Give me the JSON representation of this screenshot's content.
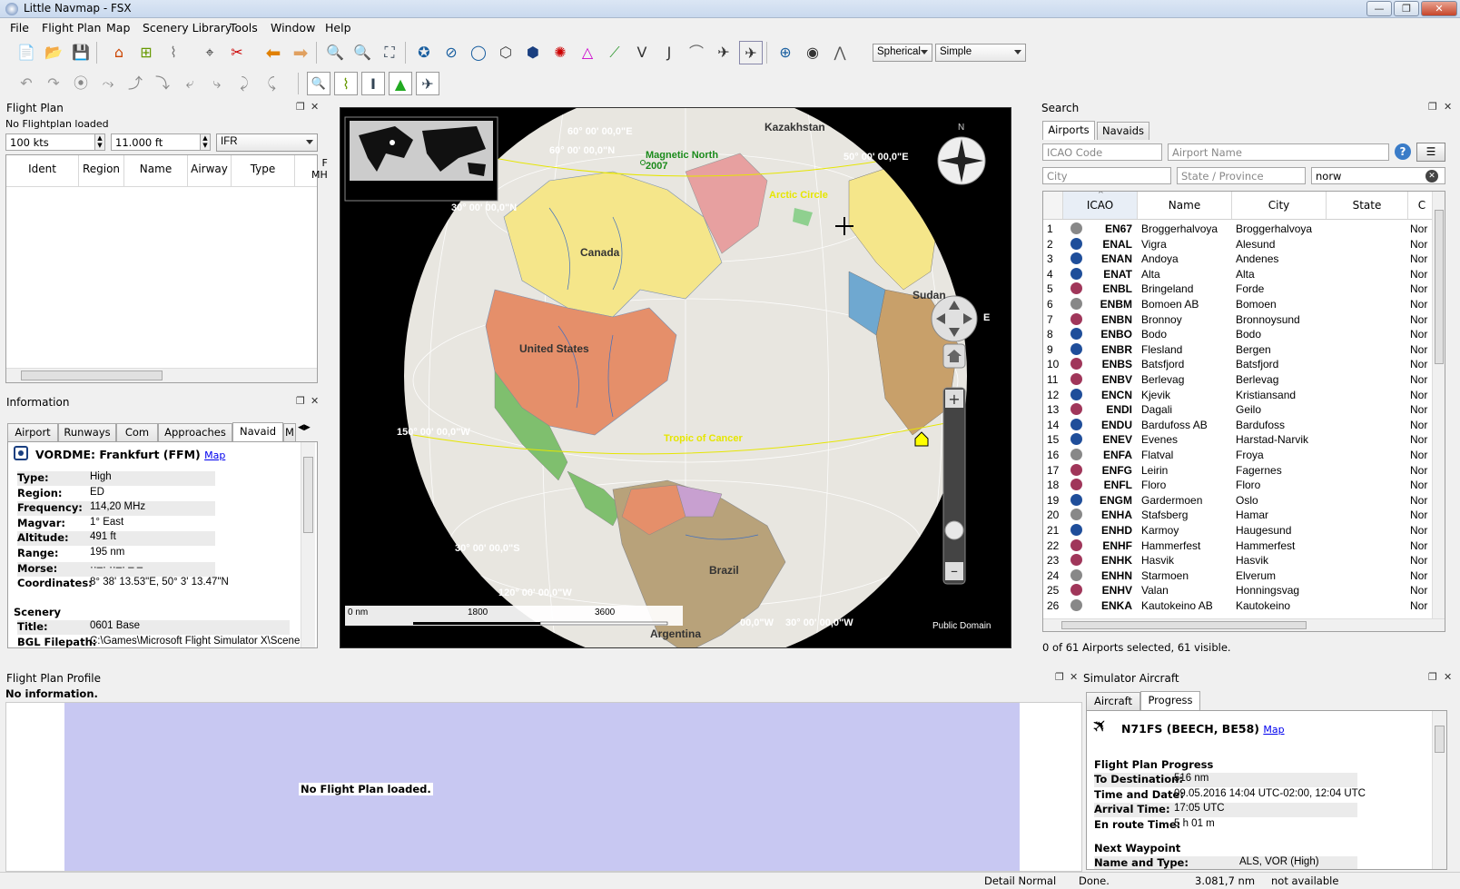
{
  "window": {
    "title": "Little Navmap - FSX"
  },
  "menu": [
    "File",
    "Flight Plan",
    "Map",
    "Scenery Library",
    "Tools",
    "Window",
    "Help"
  ],
  "toolbar": {
    "projection": "Spherical",
    "theme": "Simple"
  },
  "flight_plan": {
    "dock_title": "Flight Plan",
    "status": "No Flightplan loaded",
    "speed": "100 kts",
    "altitude": "11.000 ft",
    "rules": "IFR",
    "columns": [
      "Ident",
      "Region",
      "Name",
      "Airway",
      "Type"
    ],
    "col_cut_top": "F",
    "col_cut_bot": "MH"
  },
  "information": {
    "dock_title": "Information",
    "tabs": [
      "Airport",
      "Runways",
      "Com",
      "Approaches",
      "Navaid",
      "M"
    ],
    "heading": "VORDME: Frankfurt (FFM)",
    "map_link": "Map",
    "rows": [
      {
        "k": "Type:",
        "v": "High"
      },
      {
        "k": "Region:",
        "v": "ED"
      },
      {
        "k": "Frequency:",
        "v": "114,20 MHz"
      },
      {
        "k": "Magvar:",
        "v": "1° East"
      },
      {
        "k": "Altitude:",
        "v": "491 ft"
      },
      {
        "k": "Range:",
        "v": "195 nm"
      },
      {
        "k": "Morse:",
        "v": "··–·  ··–·  – –"
      },
      {
        "k": "Coordinates:",
        "v": "8° 38' 13.53\"E, 50° 3' 13.47\"N"
      }
    ],
    "scenery_heading": "Scenery",
    "scenery_rows": [
      {
        "k": "Title:",
        "v": "0601 Base"
      },
      {
        "k": "BGL Filepath:",
        "v": "C:\\Games\\Microsoft Flight Simulator X\\Scenery"
      }
    ]
  },
  "map": {
    "labels": {
      "kazakhstan": "Kazakhstan",
      "magnetic_north": "Magnetic North",
      "mn_year": "2007",
      "canada": "Canada",
      "united_states": "United States",
      "brazil": "Brazil",
      "argentina": "Argentina",
      "sudan": "Sudan",
      "tropic": "Tropic of Cancer",
      "arctic": "Arctic Circle",
      "lat50e": "50° 00' 00,0\"E",
      "lon60": "60° 00' 00,0\"N",
      "lon60b": "60° 00' 00,0\"E",
      "lat30n": "30° 00' 00,0\"N",
      "w150": "150° 00' 00,0\"W",
      "s30": "30° 00' 00,0\"S",
      "w30": "30° 00' 00,0\"W",
      "w00": "00,0\"W",
      "w120": "120° 00' 00,0\"W",
      "e_edge": "E",
      "public_domain": "Public Domain"
    },
    "scale": {
      "s0": "0 nm",
      "s1": "1800",
      "s2": "3600"
    },
    "compass_n": "N"
  },
  "search": {
    "dock_title": "Search",
    "tabs": [
      "Airports",
      "Navaids"
    ],
    "icao_placeholder": "ICAO Code",
    "name_placeholder": "Airport Name",
    "city_placeholder": "City",
    "state_placeholder": "State / Province",
    "country_value": "norw",
    "columns": [
      "ICAO",
      "Name",
      "City",
      "State",
      "C"
    ],
    "rows": [
      {
        "n": "1",
        "icao": "EN67",
        "name": "Broggerhalvoya",
        "city": "Broggerhalvoya",
        "country": "Nor",
        "color": "#888888"
      },
      {
        "n": "2",
        "icao": "ENAL",
        "name": "Vigra",
        "city": "Alesund",
        "country": "Nor",
        "color": "#1f4e9a"
      },
      {
        "n": "3",
        "icao": "ENAN",
        "name": "Andoya",
        "city": "Andenes",
        "country": "Nor",
        "color": "#1f4e9a"
      },
      {
        "n": "4",
        "icao": "ENAT",
        "name": "Alta",
        "city": "Alta",
        "country": "Nor",
        "color": "#1f4e9a"
      },
      {
        "n": "5",
        "icao": "ENBL",
        "name": "Bringeland",
        "city": "Forde",
        "country": "Nor",
        "color": "#a0365a"
      },
      {
        "n": "6",
        "icao": "ENBM",
        "name": "Bomoen AB",
        "city": "Bomoen",
        "country": "Nor",
        "color": "#888888"
      },
      {
        "n": "7",
        "icao": "ENBN",
        "name": "Bronnoy",
        "city": "Bronnoysund",
        "country": "Nor",
        "color": "#a0365a"
      },
      {
        "n": "8",
        "icao": "ENBO",
        "name": "Bodo",
        "city": "Bodo",
        "country": "Nor",
        "color": "#1f4e9a"
      },
      {
        "n": "9",
        "icao": "ENBR",
        "name": "Flesland",
        "city": "Bergen",
        "country": "Nor",
        "color": "#1f4e9a"
      },
      {
        "n": "10",
        "icao": "ENBS",
        "name": "Batsfjord",
        "city": "Batsfjord",
        "country": "Nor",
        "color": "#a0365a"
      },
      {
        "n": "11",
        "icao": "ENBV",
        "name": "Berlevag",
        "city": "Berlevag",
        "country": "Nor",
        "color": "#a0365a"
      },
      {
        "n": "12",
        "icao": "ENCN",
        "name": "Kjevik",
        "city": "Kristiansand",
        "country": "Nor",
        "color": "#1f4e9a"
      },
      {
        "n": "13",
        "icao": "ENDI",
        "name": "Dagali",
        "city": "Geilo",
        "country": "Nor",
        "color": "#a0365a"
      },
      {
        "n": "14",
        "icao": "ENDU",
        "name": "Bardufoss AB",
        "city": "Bardufoss",
        "country": "Nor",
        "color": "#1f4e9a"
      },
      {
        "n": "15",
        "icao": "ENEV",
        "name": "Evenes",
        "city": "Harstad-Narvik",
        "country": "Nor",
        "color": "#1f4e9a"
      },
      {
        "n": "16",
        "icao": "ENFA",
        "name": "Flatval",
        "city": "Froya",
        "country": "Nor",
        "color": "#888888"
      },
      {
        "n": "17",
        "icao": "ENFG",
        "name": "Leirin",
        "city": "Fagernes",
        "country": "Nor",
        "color": "#a0365a"
      },
      {
        "n": "18",
        "icao": "ENFL",
        "name": "Floro",
        "city": "Floro",
        "country": "Nor",
        "color": "#a0365a"
      },
      {
        "n": "19",
        "icao": "ENGM",
        "name": "Gardermoen",
        "city": "Oslo",
        "country": "Nor",
        "color": "#1f4e9a"
      },
      {
        "n": "20",
        "icao": "ENHA",
        "name": "Stafsberg",
        "city": "Hamar",
        "country": "Nor",
        "color": "#888888"
      },
      {
        "n": "21",
        "icao": "ENHD",
        "name": "Karmoy",
        "city": "Haugesund",
        "country": "Nor",
        "color": "#1f4e9a"
      },
      {
        "n": "22",
        "icao": "ENHF",
        "name": "Hammerfest",
        "city": "Hammerfest",
        "country": "Nor",
        "color": "#a0365a"
      },
      {
        "n": "23",
        "icao": "ENHK",
        "name": "Hasvik",
        "city": "Hasvik",
        "country": "Nor",
        "color": "#a0365a"
      },
      {
        "n": "24",
        "icao": "ENHN",
        "name": "Starmoen",
        "city": "Elverum",
        "country": "Nor",
        "color": "#888888"
      },
      {
        "n": "25",
        "icao": "ENHV",
        "name": "Valan",
        "city": "Honningsvag",
        "country": "Nor",
        "color": "#a0365a"
      },
      {
        "n": "26",
        "icao": "ENKA",
        "name": "Kautokeino AB",
        "city": "Kautokeino",
        "country": "Nor",
        "color": "#888888"
      }
    ],
    "status": "0 of 61 Airports selected, 61 visible."
  },
  "profile": {
    "dock_title": "Flight Plan Profile",
    "status": "No information.",
    "message": "No Flight Plan loaded."
  },
  "aircraft": {
    "dock_title": "Simulator Aircraft",
    "tabs": [
      "Aircraft",
      "Progress"
    ],
    "heading": "N71FS (BEECH, BE58)",
    "map_link": "Map",
    "progress_heading": "Flight Plan Progress",
    "rows": [
      {
        "k": "To Destination:",
        "v": "516 nm"
      },
      {
        "k": "Time and Date:",
        "v": "09.05.2016 14:04 UTC-02:00, 12:04 UTC"
      },
      {
        "k": "Arrival Time:",
        "v": "17:05 UTC"
      },
      {
        "k": "En route Time:",
        "v": "5 h 01 m"
      }
    ],
    "next_heading": "Next Waypoint",
    "next_row": {
      "k": "Name and Type:",
      "v": "ALS, VOR (High)"
    }
  },
  "statusbar": {
    "detail": "Detail Normal",
    "state": "Done.",
    "distance": "3.081,7 nm",
    "extra": "not available"
  }
}
